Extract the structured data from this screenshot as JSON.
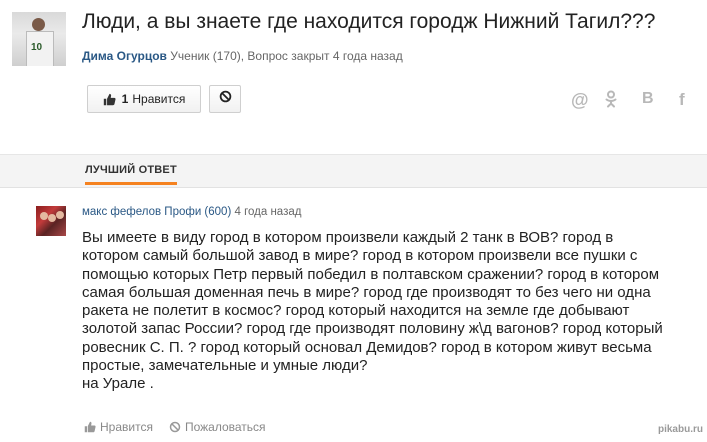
{
  "question": {
    "title": "Люди, а вы знаете где находится городж Нижний Тагил???",
    "author": "Дима Огурцов",
    "meta": "Ученик (170), Вопрос закрыт 4 года назад",
    "avatar_jersey_number": "10"
  },
  "actions": {
    "like_count": "1",
    "like_label": "Нравится"
  },
  "share": {
    "mail": "@",
    "ok": "ok",
    "vk": "B",
    "fb": "f"
  },
  "tab": {
    "label": "ЛУЧШИЙ ОТВЕТ",
    "accent_color": "#f58220"
  },
  "answer": {
    "author": "макс фефелов",
    "rank": "Профи (600)",
    "time": "4 года назад",
    "lines": [
      "Вы имеете в виду город в котором произвели каждый 2 танк в ВОВ? город в",
      "котором самый большой завод в мире? город в котором произвели все пушки с",
      "помощью которых Петр первый победил в полтавском сражении? город в котором",
      "самая большая доменная печь в мире? город где производят то без чего ни одна",
      "ракета не полетит в космос? город который находится на земле где добывают",
      "золотой запас России? город где производят половину ж\\д вагонов? город который",
      "ровесник С. П. ? город который основал Демидов? город в котором живут весьма",
      "простые, замечательные и умные люди?",
      "на Урале ."
    ],
    "like_label": "Нравится",
    "report_label": "Пожаловаться"
  },
  "watermark": "pikabu.ru"
}
